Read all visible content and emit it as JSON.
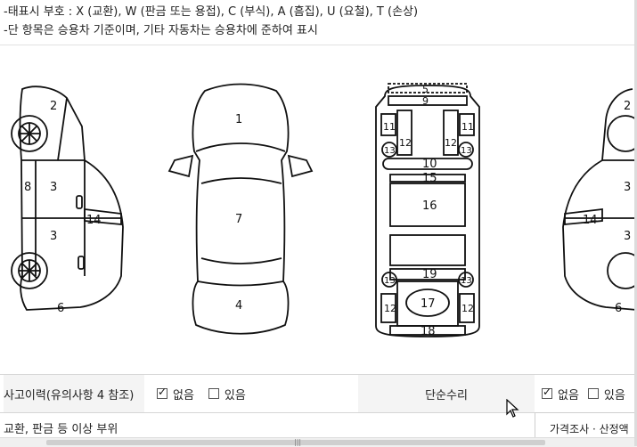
{
  "legend": {
    "line1": "-태표시 부호 : X (교환), W (판금 또는 용접), C (부식), A (흠집), U (요철), T (손상)",
    "line2": "-단 항목은 승용차 기준이며, 기타 자동차는 승용차에 준하여 표시"
  },
  "diagram": {
    "left_side": [
      "2",
      "8",
      "3",
      "3",
      "14",
      "6"
    ],
    "top": [
      "1",
      "7",
      "4"
    ],
    "under": [
      "5",
      "9",
      "11",
      "11",
      "12",
      "12",
      "13",
      "13",
      "10",
      "15",
      "16",
      "19",
      "13",
      "13",
      "17",
      "12",
      "12",
      "18"
    ],
    "right_side": [
      "2",
      "3",
      "14",
      "3",
      "6"
    ]
  },
  "accident_row": {
    "label": "사고이력(유의사항 4 참조)",
    "none_label": "없음",
    "yes_label": "있음",
    "none_checked": true,
    "yes_checked": false
  },
  "simple_repair": {
    "label": "단순수리",
    "none_label": "없음",
    "yes_label": "있음",
    "none_checked": true,
    "yes_checked": false
  },
  "second_row": {
    "label": "교환, 판금 등 이상 부위"
  },
  "tab": {
    "label": "가격조사 · 산정액"
  }
}
